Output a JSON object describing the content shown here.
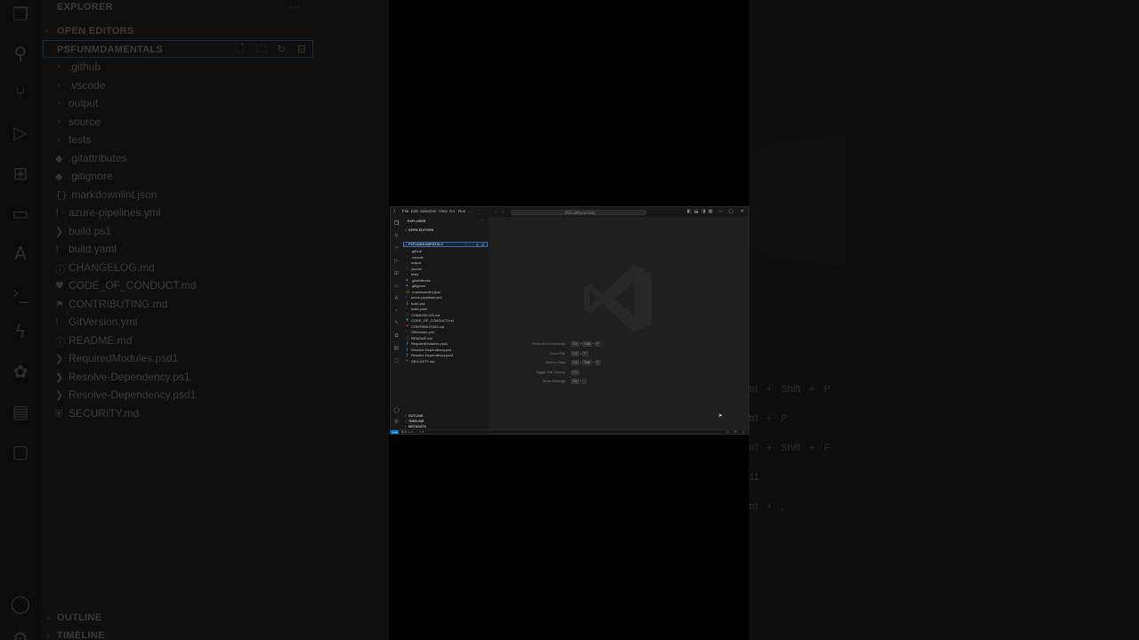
{
  "window": {
    "menu": [
      "File",
      "Edit",
      "Selection",
      "View",
      "Go",
      "Run",
      "…"
    ],
    "search_text": "PSFunMamentals",
    "layout_icons": [
      "sidebar-toggle-icon",
      "panel-toggle-icon",
      "secondary-sidebar-icon",
      "customize-layout-icon"
    ],
    "controls": [
      "—",
      "□",
      "✕"
    ]
  },
  "activity_bar": {
    "icons": [
      "files-icon",
      "search-icon",
      "source-control-icon",
      "run-debug-icon",
      "extensions-icon",
      "remote-explorer-icon",
      "azure-icon",
      "terminal-icon",
      "lightning-icon",
      "octopus-icon",
      "testing-icon",
      "chat-icon"
    ],
    "bottom_icons": [
      "account-icon",
      "settings-gear-icon"
    ]
  },
  "sidebar": {
    "title": "EXPLORER",
    "open_editors": "OPEN EDITORS",
    "root": "PSFUNMDAMENTALS",
    "tree": [
      {
        "name": ".github",
        "type": "folder"
      },
      {
        "name": ".vscode",
        "type": "folder"
      },
      {
        "name": "output",
        "type": "folder"
      },
      {
        "name": "source",
        "type": "folder"
      },
      {
        "name": "tests",
        "type": "folder"
      },
      {
        "name": ".gitattributes",
        "type": "file",
        "icon": "◆",
        "color": "#6e6e6e"
      },
      {
        "name": ".gitignore",
        "type": "file",
        "icon": "◆",
        "color": "#6e6e6e"
      },
      {
        "name": ".markdownlint.json",
        "type": "file",
        "icon": "{}",
        "color": "#c9b53b"
      },
      {
        "name": "azure-pipelines.yml",
        "type": "file",
        "icon": "!",
        "color": "#b07ad0"
      },
      {
        "name": "build.ps1",
        "type": "file",
        "icon": "❯",
        "color": "#4a8fd6"
      },
      {
        "name": "build.yaml",
        "type": "file",
        "icon": "!",
        "color": "#b07ad0"
      },
      {
        "name": "CHANGELOG.md",
        "type": "file",
        "icon": "ⓘ",
        "color": "#6e6e6e"
      },
      {
        "name": "CODE_OF_CONDUCT.md",
        "type": "file",
        "icon": "♥",
        "color": "#3f8f5f"
      },
      {
        "name": "CONTRIBUTING.md",
        "type": "file",
        "icon": "⚑",
        "color": "#c0392b"
      },
      {
        "name": "GitVersion.yml",
        "type": "file",
        "icon": "!",
        "color": "#b07ad0"
      },
      {
        "name": "README.md",
        "type": "file",
        "icon": "ⓘ",
        "color": "#4a8fd6"
      },
      {
        "name": "RequiredModules.psd1",
        "type": "file",
        "icon": "❯",
        "color": "#4a8fd6"
      },
      {
        "name": "Resolve-Dependency.ps1",
        "type": "file",
        "icon": "❯",
        "color": "#4a8fd6"
      },
      {
        "name": "Resolve-Dependency.psd1",
        "type": "file",
        "icon": "❯",
        "color": "#4a8fd6"
      },
      {
        "name": "SECURITY.md",
        "type": "file",
        "icon": "⛨",
        "color": "#3f8f5f"
      }
    ],
    "outline": "OUTLINE",
    "timeline": "TIMELINE",
    "metadata": "METADATA"
  },
  "editor": {
    "hints": [
      {
        "label": "Show All Commands",
        "keys": [
          "Ctrl",
          "+",
          "Shift",
          "+",
          "P"
        ]
      },
      {
        "label": "Go to File",
        "keys": [
          "Ctrl",
          "+",
          "P"
        ]
      },
      {
        "label": "Find in Files",
        "keys": [
          "Ctrl",
          "+",
          "Shift",
          "+",
          "F"
        ]
      },
      {
        "label": "Toggle Full Screen",
        "keys": [
          "F11"
        ]
      },
      {
        "label": "Show Settings",
        "keys": [
          "Ctrl",
          "+",
          ","
        ]
      }
    ]
  },
  "status_bar": {
    "left": "⊗ 0 ⚠ 0",
    "ports": "⑂ 0",
    "right_icons": [
      "copilot-icon",
      "sync-icon",
      "bell-icon"
    ]
  },
  "backdrop": {
    "title": "EXPLORER",
    "open_editors": "OPEN EDITORS",
    "root": "PSFUNMDAMENTALS",
    "outline": "OUTLINE",
    "timeline": "TIMELINE",
    "right_keys": [
      [
        "trl",
        "+",
        "Shift",
        "+",
        "P"
      ],
      [
        "trl",
        "+",
        "P"
      ],
      [
        "trl",
        "+",
        "Shift",
        "+",
        "F"
      ],
      [
        "11"
      ],
      [
        "trl",
        "+",
        ","
      ]
    ]
  }
}
